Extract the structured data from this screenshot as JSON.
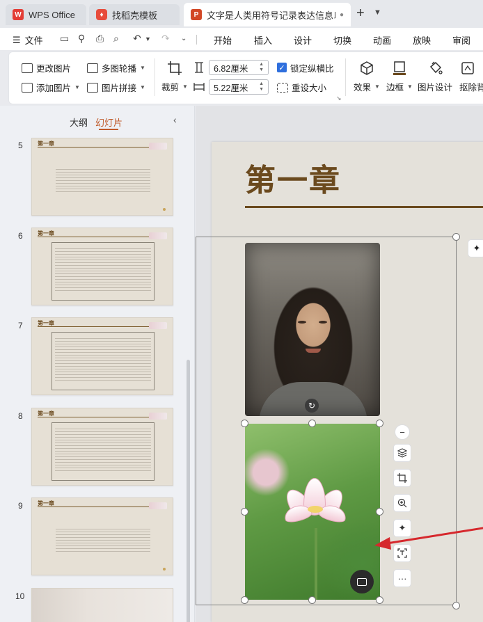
{
  "tabs": [
    {
      "label": "WPS Office",
      "icon": "wps-logo-icon"
    },
    {
      "label": "找稻壳模板",
      "icon": "docer-icon"
    },
    {
      "label": "文字是人类用符号记录表达信息以",
      "icon": "presentation-icon",
      "active": true
    }
  ],
  "menubar": {
    "file_label": "文件",
    "tabs": [
      "开始",
      "插入",
      "设计",
      "切换",
      "动画",
      "放映",
      "审阅"
    ]
  },
  "ribbon": {
    "change_image": "更改图片",
    "add_image": "添加图片",
    "multi_carousel": "多图轮播",
    "image_splice": "图片拼接",
    "crop": "裁剪",
    "width_value": "6.82厘米",
    "height_value": "5.22厘米",
    "lock_ratio": "锁定纵横比",
    "lock_ratio_checked": true,
    "resize": "重设大小",
    "effects": "效果",
    "border": "边框",
    "image_design": "图片设计",
    "remove_bg": "抠除背"
  },
  "left_panel": {
    "tab_outline": "大纲",
    "tab_slides": "幻灯片",
    "slides": [
      {
        "number": "5",
        "title": "第一章",
        "style": "text"
      },
      {
        "number": "6",
        "title": "第一章",
        "style": "boxed"
      },
      {
        "number": "7",
        "title": "第一章",
        "style": "boxed"
      },
      {
        "number": "8",
        "title": "第一章",
        "style": "boxed"
      },
      {
        "number": "9",
        "title": "第一章",
        "style": "text"
      },
      {
        "number": "10",
        "title": "",
        "style": "photo"
      }
    ]
  },
  "slide": {
    "title": "第一章"
  },
  "colors": {
    "accent_brown": "#6b4a1e",
    "arrow_red": "#d6282d",
    "active_tab": "#c05a2a",
    "checkbox_blue": "#2f6fdd"
  }
}
